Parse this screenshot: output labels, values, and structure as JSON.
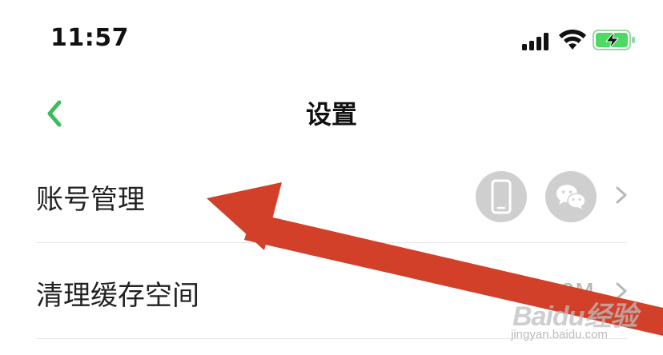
{
  "status_bar": {
    "time": "11:57",
    "signal_icon": "cellular-signal-icon",
    "wifi_icon": "wifi-icon",
    "battery_icon": "battery-charging-icon",
    "battery_color": "#4cd964"
  },
  "nav": {
    "title": "设置",
    "back_icon": "chevron-left-icon",
    "accent_color": "#3dbb5c"
  },
  "settings": {
    "items": [
      {
        "label": "账号管理",
        "icons": [
          "phone-icon",
          "wechat-icon"
        ]
      },
      {
        "label": "清理缓存空间",
        "value": "...0M"
      }
    ]
  },
  "annotation": {
    "arrow_color": "#d2402a"
  },
  "watermark": {
    "brand": "Baidu经验",
    "url": "jingyan.baidu.com"
  }
}
